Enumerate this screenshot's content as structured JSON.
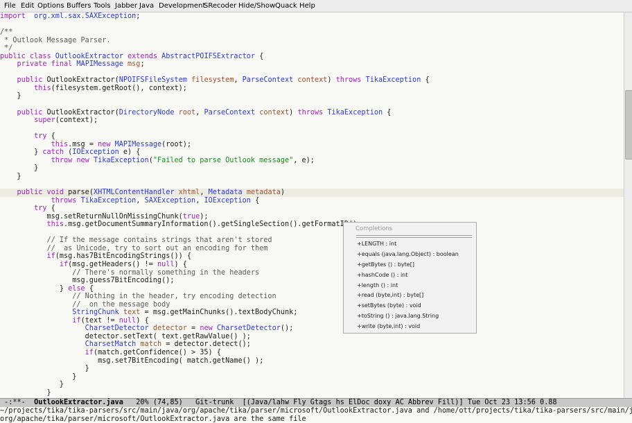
{
  "menu": [
    "File",
    "Edit",
    "Options",
    "Buffers",
    "Tools",
    "Jabber",
    "Java",
    "Development",
    "SRecoder",
    "Hide/Show",
    "Quack",
    "Help"
  ],
  "code_lines": [
    {
      "segs": [
        [
          "kw",
          "import"
        ],
        [
          "",
          "  "
        ],
        [
          "ty",
          "org.xml.sax.SAXException"
        ],
        [
          "",
          ";"
        ]
      ]
    },
    {
      "segs": []
    },
    {
      "segs": [
        [
          "cm",
          "/**"
        ]
      ]
    },
    {
      "segs": [
        [
          "cm",
          " * Outlook Message Parser."
        ]
      ]
    },
    {
      "segs": [
        [
          "cm",
          " */"
        ]
      ]
    },
    {
      "segs": [
        [
          "kw",
          "public class"
        ],
        [
          "",
          " "
        ],
        [
          "ty",
          "OutlookExtractor"
        ],
        [
          "",
          " "
        ],
        [
          "kw",
          "extends"
        ],
        [
          "",
          " "
        ],
        [
          "ty",
          "AbstractPOIFSExtractor"
        ],
        [
          "",
          " {"
        ]
      ]
    },
    {
      "segs": [
        [
          "",
          "    "
        ],
        [
          "kw",
          "private final"
        ],
        [
          "",
          " "
        ],
        [
          "ty",
          "MAPIMessage"
        ],
        [
          "",
          " "
        ],
        [
          "va",
          "msg"
        ],
        [
          "",
          ";"
        ]
      ]
    },
    {
      "segs": []
    },
    {
      "segs": [
        [
          "",
          "    "
        ],
        [
          "kw",
          "public"
        ],
        [
          "",
          " OutlookExtractor("
        ],
        [
          "ty",
          "NPOIFSFileSystem"
        ],
        [
          "",
          " "
        ],
        [
          "va",
          "filesystem"
        ],
        [
          "",
          ", "
        ],
        [
          "ty",
          "ParseContext"
        ],
        [
          "",
          " "
        ],
        [
          "va",
          "context"
        ],
        [
          "",
          ") "
        ],
        [
          "kw",
          "throws"
        ],
        [
          "",
          " "
        ],
        [
          "ty",
          "TikaException"
        ],
        [
          "",
          " {"
        ]
      ]
    },
    {
      "segs": [
        [
          "",
          "        "
        ],
        [
          "kw",
          "this"
        ],
        [
          "",
          "(filesystem.getRoot(), context);"
        ]
      ]
    },
    {
      "segs": [
        [
          "",
          "    }"
        ]
      ]
    },
    {
      "segs": []
    },
    {
      "segs": [
        [
          "",
          "    "
        ],
        [
          "kw",
          "public"
        ],
        [
          "",
          " OutlookExtractor("
        ],
        [
          "ty",
          "DirectoryNode"
        ],
        [
          "",
          " "
        ],
        [
          "va",
          "root"
        ],
        [
          "",
          ", "
        ],
        [
          "ty",
          "ParseContext"
        ],
        [
          "",
          " "
        ],
        [
          "va",
          "context"
        ],
        [
          "",
          ") "
        ],
        [
          "kw",
          "throws"
        ],
        [
          "",
          " "
        ],
        [
          "ty",
          "TikaException"
        ],
        [
          "",
          " {"
        ]
      ]
    },
    {
      "segs": [
        [
          "",
          "        "
        ],
        [
          "kw",
          "super"
        ],
        [
          "",
          "(context);"
        ]
      ]
    },
    {
      "segs": []
    },
    {
      "segs": [
        [
          "",
          "        "
        ],
        [
          "kw",
          "try"
        ],
        [
          "",
          " {"
        ]
      ]
    },
    {
      "segs": [
        [
          "",
          "            "
        ],
        [
          "kw",
          "this"
        ],
        [
          "",
          ".msg = "
        ],
        [
          "kw",
          "new"
        ],
        [
          "",
          " "
        ],
        [
          "ty",
          "MAPIMessage"
        ],
        [
          "",
          "(root);"
        ]
      ]
    },
    {
      "segs": [
        [
          "",
          "        } "
        ],
        [
          "kw",
          "catch"
        ],
        [
          "",
          " ("
        ],
        [
          "ty",
          "IOException"
        ],
        [
          "",
          " e) {"
        ]
      ]
    },
    {
      "segs": [
        [
          "",
          "            "
        ],
        [
          "kw",
          "throw new"
        ],
        [
          "",
          " "
        ],
        [
          "ty",
          "TikaException"
        ],
        [
          "",
          "("
        ],
        [
          "st",
          "\"Failed to parse Outlook message\""
        ],
        [
          "",
          ", e);"
        ]
      ]
    },
    {
      "segs": [
        [
          "",
          "        }"
        ]
      ]
    },
    {
      "segs": [
        [
          "",
          "    }"
        ]
      ]
    },
    {
      "segs": []
    },
    {
      "hl": true,
      "segs": [
        [
          "",
          "    "
        ],
        [
          "kw",
          "public void"
        ],
        [
          "",
          " parse("
        ],
        [
          "ty",
          "XHTMLContentHandler"
        ],
        [
          "",
          " "
        ],
        [
          "va",
          "xhtml"
        ],
        [
          "",
          ", "
        ],
        [
          "ty",
          "Metadata"
        ],
        [
          "",
          " "
        ],
        [
          "va",
          "metadata"
        ],
        [
          "",
          ")"
        ]
      ]
    },
    {
      "segs": [
        [
          "",
          "            "
        ],
        [
          "kw",
          "throws"
        ],
        [
          "",
          " "
        ],
        [
          "ty",
          "TikaException"
        ],
        [
          "",
          ", "
        ],
        [
          "ty",
          "SAXException"
        ],
        [
          "",
          ", "
        ],
        [
          "ty",
          "IOException"
        ],
        [
          "",
          " {"
        ]
      ]
    },
    {
      "segs": [
        [
          "",
          "        "
        ],
        [
          "kw",
          "try"
        ],
        [
          "",
          " {"
        ]
      ]
    },
    {
      "segs": [
        [
          "",
          "           msg.setReturnNullOnMissingChunk("
        ],
        [
          "kw",
          "true"
        ],
        [
          "",
          ");"
        ]
      ]
    },
    {
      "segs": [
        [
          "",
          "           "
        ],
        [
          "kw",
          "this"
        ],
        [
          "",
          ".msg.getDocumentSummaryInformation().getSingleSection().getFormatID()"
        ]
      ]
    },
    {
      "segs": []
    },
    {
      "segs": [
        [
          "",
          "           "
        ],
        [
          "cm",
          "// If the message contains strings that aren't stored"
        ]
      ]
    },
    {
      "segs": [
        [
          "",
          "           "
        ],
        [
          "cm",
          "//  as Unicode, try to sort out an encoding for them"
        ]
      ]
    },
    {
      "segs": [
        [
          "",
          "           "
        ],
        [
          "kw",
          "if"
        ],
        [
          "",
          "(msg.has7BitEncodingStrings()) {"
        ]
      ]
    },
    {
      "segs": [
        [
          "",
          "              "
        ],
        [
          "kw",
          "if"
        ],
        [
          "",
          "(msg.getHeaders() != "
        ],
        [
          "kw",
          "null"
        ],
        [
          "",
          ") {"
        ]
      ]
    },
    {
      "segs": [
        [
          "",
          "                 "
        ],
        [
          "cm",
          "// There's normally something in the headers"
        ]
      ]
    },
    {
      "segs": [
        [
          "",
          "                 msg.guess7BitEncoding();"
        ]
      ]
    },
    {
      "segs": [
        [
          "",
          "              } "
        ],
        [
          "kw",
          "else"
        ],
        [
          "",
          " {"
        ]
      ]
    },
    {
      "segs": [
        [
          "",
          "                 "
        ],
        [
          "cm",
          "// Nothing in the header, try encoding detection"
        ]
      ]
    },
    {
      "segs": [
        [
          "",
          "                 "
        ],
        [
          "cm",
          "//  on the message body"
        ]
      ]
    },
    {
      "segs": [
        [
          "",
          "                 "
        ],
        [
          "ty",
          "StringChunk"
        ],
        [
          "",
          " "
        ],
        [
          "va",
          "text"
        ],
        [
          "",
          " = msg.getMainChunks().textBodyChunk;"
        ]
      ]
    },
    {
      "segs": [
        [
          "",
          "                 "
        ],
        [
          "kw",
          "if"
        ],
        [
          "",
          "(text != "
        ],
        [
          "kw",
          "null"
        ],
        [
          "",
          ") {"
        ]
      ]
    },
    {
      "segs": [
        [
          "",
          "                    "
        ],
        [
          "ty",
          "CharsetDetector"
        ],
        [
          "",
          " "
        ],
        [
          "va",
          "detector"
        ],
        [
          "",
          " = "
        ],
        [
          "kw",
          "new"
        ],
        [
          "",
          " "
        ],
        [
          "ty",
          "CharsetDetector"
        ],
        [
          "",
          "();"
        ]
      ]
    },
    {
      "segs": [
        [
          "",
          "                    detector.setText( text.getRawValue() );"
        ]
      ]
    },
    {
      "segs": [
        [
          "",
          "                    "
        ],
        [
          "ty",
          "CharsetMatch"
        ],
        [
          "",
          " "
        ],
        [
          "va",
          "match"
        ],
        [
          "",
          " = detector.detect();"
        ]
      ]
    },
    {
      "segs": [
        [
          "",
          "                    "
        ],
        [
          "kw",
          "if"
        ],
        [
          "",
          "(match.getConfidence() > 35) {"
        ]
      ]
    },
    {
      "segs": [
        [
          "",
          "                       msg.set7BitEncoding( match.getName() );"
        ]
      ]
    },
    {
      "segs": [
        [
          "",
          "                    }"
        ]
      ]
    },
    {
      "segs": [
        [
          "",
          "                 }"
        ]
      ]
    },
    {
      "segs": [
        [
          "",
          "              }"
        ]
      ]
    },
    {
      "segs": [
        [
          "",
          "           }"
        ]
      ]
    }
  ],
  "completions": {
    "title": "Completions",
    "items": [
      "+LENGTH : int",
      "+equals (java.lang.Object) : boolean",
      "+getBytes () : byte[]",
      "+hashCode () : int",
      "+length () : int",
      "+read (byte,int) : byte[]",
      "+setBytes (byte) : void",
      "+toString () : java.lang.String",
      "+write (byte,int) : void"
    ]
  },
  "modeline": {
    "status": " -:**-  ",
    "buffer": "OutlookExtractor.java",
    "position": "   20% (74,85)",
    "vc": "   Git-trunk",
    "modes": "  [(Java/lahw Fly Gtags hs ElDoc doxy AC Abbrev Fill)] Tue Oct 23 13:56 0.88"
  },
  "minibuffer": {
    "line1": "~/projects/tika/tika-parsers/src/main/java/org/apache/tika/parser/microsoft/OutlookExtractor.java and /home/ott/projects/tika/tika-parsers/src/main/java/",
    "line2": "org/apache/tika/parser/microsoft/OutlookExtractor.java are the same file"
  }
}
